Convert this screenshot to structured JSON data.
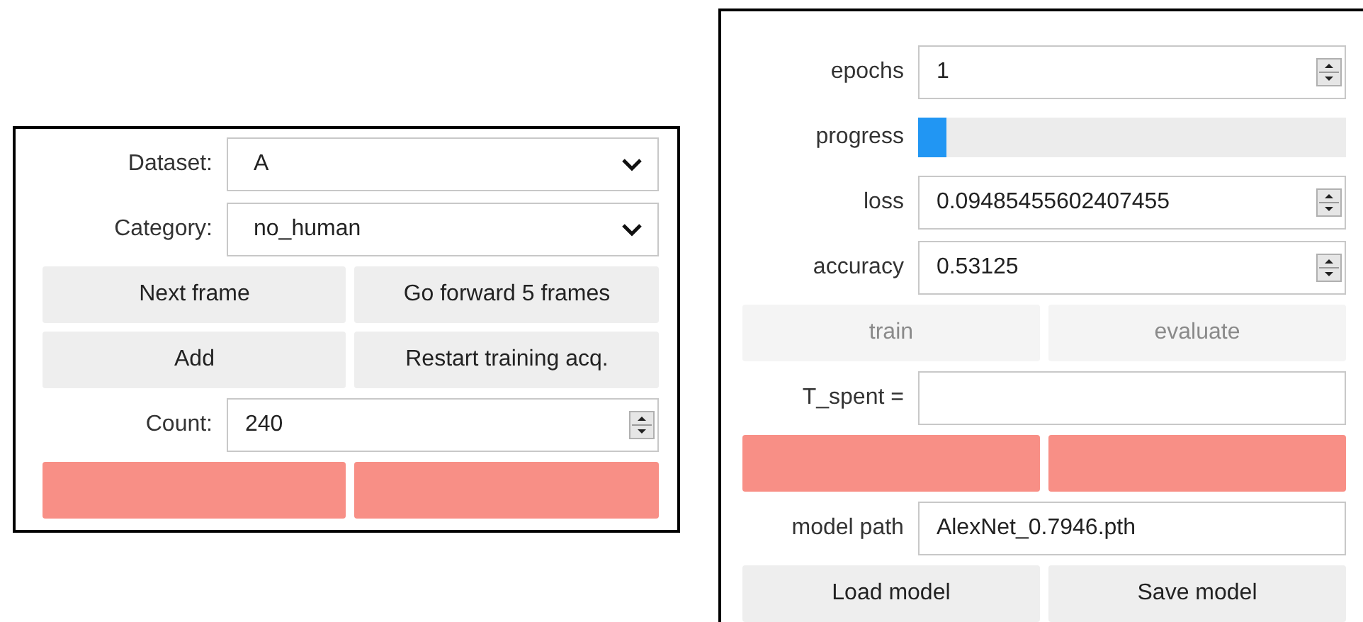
{
  "acquisition_panel": {
    "rows": [
      {
        "kind": "combo",
        "label": "Dataset:",
        "value": "A"
      },
      {
        "kind": "combo",
        "label": "Category:",
        "value": "no_human"
      },
      {
        "kind": "buttons",
        "buttons": [
          {
            "label": "Next frame",
            "kind": "normal",
            "disabled": false
          },
          {
            "label": "Go forward 5 frames",
            "kind": "normal",
            "disabled": false
          }
        ]
      },
      {
        "kind": "buttons",
        "buttons": [
          {
            "label": "Add",
            "kind": "normal",
            "disabled": false
          },
          {
            "label": "Restart training acq.",
            "kind": "normal",
            "disabled": false
          }
        ]
      },
      {
        "kind": "spin",
        "label": "Count:",
        "value": "240"
      },
      {
        "kind": "buttons",
        "buttons": [
          {
            "kind": "highlight"
          },
          {
            "kind": "highlight"
          }
        ]
      }
    ]
  },
  "training_panel": {
    "rows": [
      {
        "kind": "spin",
        "label": "epochs",
        "value": "1"
      },
      {
        "kind": "progress",
        "label": "progress",
        "level": 0.065
      },
      {
        "kind": "spin",
        "label": "loss",
        "value": "0.09485455602407455"
      },
      {
        "kind": "spin",
        "label": "accuracy",
        "value": "0.53125"
      },
      {
        "kind": "buttons",
        "buttons": [
          {
            "label": "train",
            "kind": "normal",
            "disabled": true
          },
          {
            "label": "evaluate",
            "kind": "normal",
            "disabled": true
          }
        ]
      },
      {
        "kind": "text",
        "label": "T_spent ="
      },
      {
        "kind": "buttons",
        "buttons": [
          {
            "kind": "highlight"
          },
          {
            "kind": "highlight"
          }
        ]
      },
      {
        "kind": "text",
        "label": "model path",
        "value": "AlexNet_0.7946.pth"
      },
      {
        "kind": "buttons",
        "buttons": [
          {
            "label": "Load model",
            "kind": "normal",
            "disabled": false
          },
          {
            "label": "Save model",
            "kind": "normal",
            "disabled": false
          }
        ]
      }
    ]
  }
}
